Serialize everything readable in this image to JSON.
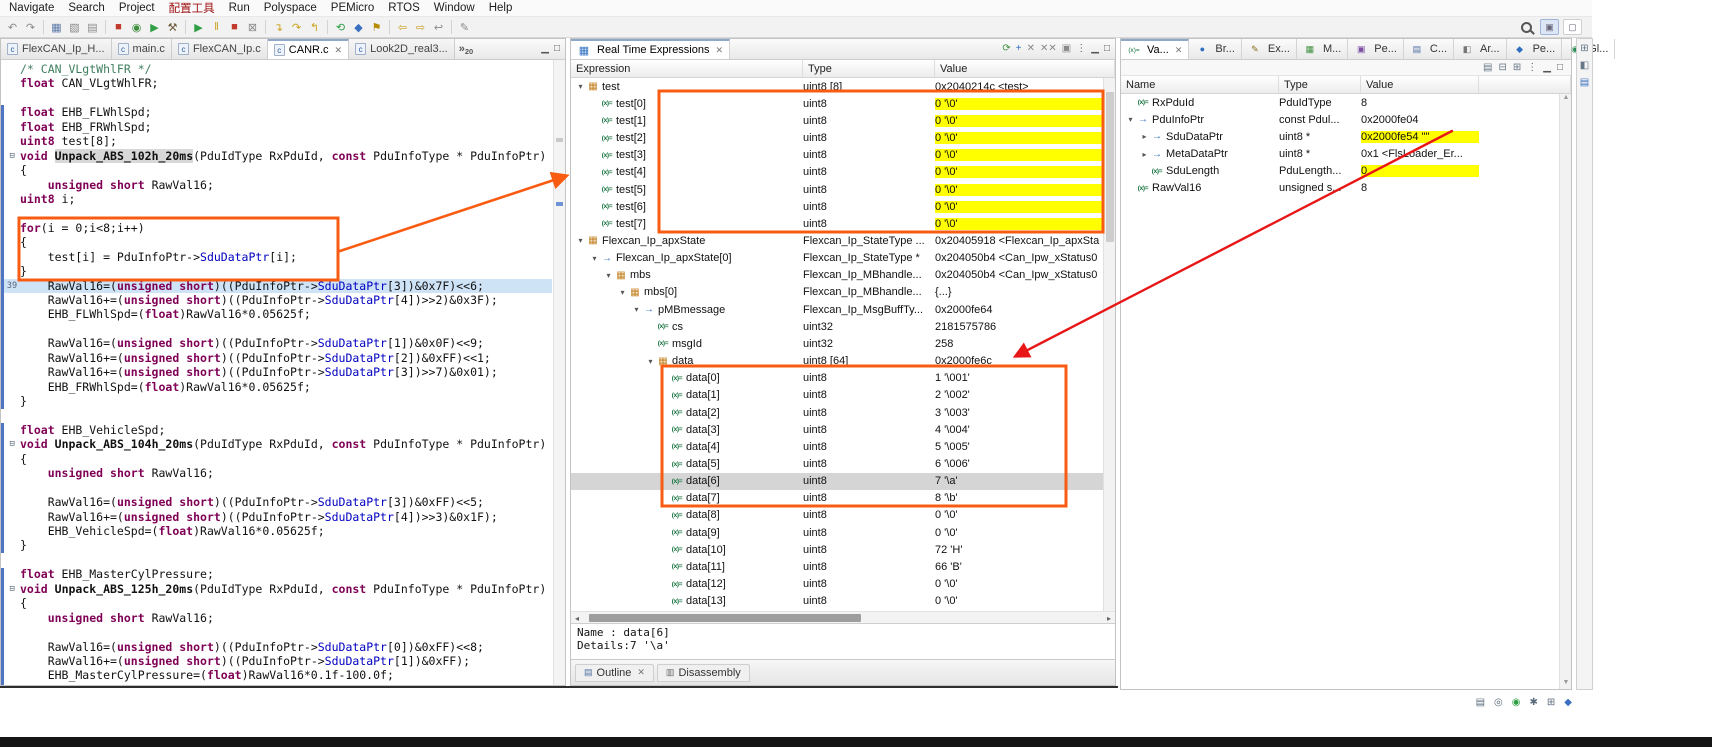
{
  "colors": {
    "annotation_orange": "#f85c12",
    "annotation_red": "#e81717",
    "highlight_yellow": "#ffff00",
    "current_line_blue": "#cfe3f7",
    "selection_gray": "#d5d5d5",
    "keyword_maroon": "#7f0055",
    "comment_green": "#3f7f5f",
    "member_blue": "#0000c0",
    "menu_accent_red": "#a01313",
    "change_bar_blue": "#4f74c4"
  },
  "menu": {
    "items": [
      {
        "id": "navigate",
        "label": "Navigate"
      },
      {
        "id": "search",
        "label": "Search"
      },
      {
        "id": "project",
        "label": "Project"
      },
      {
        "id": "config-tool",
        "label": "配置工具",
        "accent": true
      },
      {
        "id": "run",
        "label": "Run"
      },
      {
        "id": "polyspace",
        "label": "Polyspace"
      },
      {
        "id": "pemicro",
        "label": "PEMicro"
      },
      {
        "id": "rtos",
        "label": "RTOS"
      },
      {
        "id": "window",
        "label": "Window"
      },
      {
        "id": "help",
        "label": "Help"
      }
    ]
  },
  "toolbar": {
    "items": [
      {
        "name": "undo-icon",
        "glyph": "↶",
        "color": "#8a8a8a"
      },
      {
        "name": "redo-icon",
        "glyph": "↷",
        "color": "#8a8a8a"
      },
      {
        "sep": true
      },
      {
        "name": "save-icon",
        "glyph": "▦",
        "color": "#5b7aa8"
      },
      {
        "name": "save-all-icon",
        "glyph": "▧",
        "color": "#8a8a8a"
      },
      {
        "name": "print-icon",
        "glyph": "▤",
        "color": "#8a8a8a"
      },
      {
        "sep": true
      },
      {
        "name": "stop-icon",
        "glyph": "■",
        "color": "#c0392b"
      },
      {
        "name": "debug-icon",
        "glyph": "◉",
        "color": "#3f8f3f"
      },
      {
        "name": "run-icon",
        "glyph": "▶",
        "color": "#2f9e44"
      },
      {
        "name": "build-icon",
        "glyph": "⚒",
        "color": "#6e5b3c"
      },
      {
        "sep": true
      },
      {
        "name": "resume-icon",
        "glyph": "▶",
        "color": "#2f9e44"
      },
      {
        "name": "suspend-icon",
        "glyph": "‖",
        "color": "#caa21a"
      },
      {
        "name": "terminate-icon",
        "glyph": "■",
        "color": "#c0392b"
      },
      {
        "name": "disconnect-icon",
        "glyph": "⊠",
        "color": "#8a8a8a"
      },
      {
        "sep": true
      },
      {
        "name": "step-into-icon",
        "glyph": "↴",
        "color": "#caa21a"
      },
      {
        "name": "step-over-icon",
        "glyph": "↷",
        "color": "#caa21a"
      },
      {
        "name": "step-return-icon",
        "glyph": "↰",
        "color": "#caa21a"
      },
      {
        "sep": true
      },
      {
        "name": "restart-icon",
        "glyph": "⟲",
        "color": "#2f9e44"
      },
      {
        "name": "pemicro-tool-icon",
        "glyph": "◆",
        "color": "#3b6fbf"
      },
      {
        "name": "flag-icon",
        "glyph": "⚑",
        "color": "#b58900"
      },
      {
        "sep": true
      },
      {
        "name": "back-icon",
        "glyph": "⇦",
        "color": "#c9a227"
      },
      {
        "name": "forward-icon",
        "glyph": "⇨",
        "color": "#c9a227"
      },
      {
        "name": "last-edit-icon",
        "glyph": "↩",
        "color": "#8a8a8a"
      },
      {
        "sep": true
      },
      {
        "name": "annotation-icon",
        "glyph": "✎",
        "color": "#8a8a8a"
      }
    ]
  },
  "editor": {
    "tabs": [
      {
        "label": "FlexCAN_Ip_H...",
        "selected": false
      },
      {
        "label": "main.c",
        "selected": false
      },
      {
        "label": "FlexCAN_Ip.c",
        "selected": false
      },
      {
        "label": "CANR.c",
        "selected": true
      },
      {
        "label": "Look2D_real3...",
        "selected": false
      }
    ],
    "overflow": {
      "glyph": "»",
      "count": "20"
    },
    "window_icons": [
      {
        "name": "minimize-icon",
        "glyph": "▁",
        "color": "#555555"
      },
      {
        "name": "maximize-icon",
        "glyph": "□",
        "color": "#555555"
      }
    ],
    "gutter_number": "39",
    "current_line": 15,
    "fold_lines": [
      6,
      26,
      36
    ],
    "lines": [
      "/* CAN_VLgtWhlFR */",
      "float CAN_VLgtWhlFR;",
      "",
      "float EHB_FLWhlSpd;",
      "float EHB_FRWhlSpd;",
      "uint8 test[8];",
      "void Unpack_ABS_102h_20ms(PduIdType RxPduId, const PduInfoType * PduInfoPtr)",
      "{",
      "    unsigned short RawVal16;",
      "uint8 i;",
      "",
      "for(i = 0;i<8;i++)",
      "{",
      "    test[i] = PduInfoPtr->SduDataPtr[i];",
      "}",
      "    RawVal16=(unsigned short)((PduInfoPtr->SduDataPtr[3])&0x7F)<<6;",
      "    RawVal16+=(unsigned short)((PduInfoPtr->SduDataPtr[4])>>2)&0x3F);",
      "    EHB_FLWhlSpd=(float)RawVal16*0.05625f;",
      "",
      "    RawVal16=(unsigned short)((PduInfoPtr->SduDataPtr[1])&0x0F)<<9;",
      "    RawVal16+=(unsigned short)((PduInfoPtr->SduDataPtr[2])&0xFF)<<1;",
      "    RawVal16+=(unsigned short)((PduInfoPtr->SduDataPtr[3])>>7)&0x01);",
      "    EHB_FRWhlSpd=(float)RawVal16*0.05625f;",
      "}",
      "",
      "float EHB_VehicleSpd;",
      "void Unpack_ABS_104h_20ms(PduIdType RxPduId, const PduInfoType * PduInfoPtr)",
      "{",
      "    unsigned short RawVal16;",
      "",
      "    RawVal16=(unsigned short)((PduInfoPtr->SduDataPtr[3])&0xFF)<<5;",
      "    RawVal16+=(unsigned short)((PduInfoPtr->SduDataPtr[4])>>3)&0x1F);",
      "    EHB_VehicleSpd=(float)RawVal16*0.05625f;",
      "}",
      "",
      "float EHB_MasterCylPressure;",
      "void Unpack_ABS_125h_20ms(PduIdType RxPduId, const PduInfoType * PduInfoPtr)",
      "{",
      "    unsigned short RawVal16;",
      "",
      "    RawVal16=(unsigned short)((PduInfoPtr->SduDataPtr[0])&0xFF)<<8;",
      "    RawVal16+=(unsigned short)((PduInfoPtr->SduDataPtr[1])&0xFF);",
      "    EHB_MasterCylPressure=(float)RawVal16*0.1f-100.0f;"
    ]
  },
  "rte": {
    "title": "Real Time Expressions",
    "columns": [
      "Expression",
      "Type",
      "Value"
    ],
    "header_icons": [
      {
        "name": "refresh-icon",
        "glyph": "⟳",
        "color": "#3f8f3f"
      },
      {
        "name": "add-expression-icon",
        "glyph": "+",
        "color": "#2f6fc0"
      },
      {
        "name": "remove-icon",
        "glyph": "✕",
        "color": "#888888"
      },
      {
        "name": "remove-all-icon",
        "glyph": "✕✕",
        "color": "#888888"
      },
      {
        "name": "snapshot-icon",
        "glyph": "▣",
        "color": "#888888"
      },
      {
        "name": "view-menu-icon",
        "glyph": "⋮",
        "color": "#555555"
      },
      {
        "name": "minimize-icon",
        "glyph": "▁",
        "color": "#555555"
      },
      {
        "name": "maximize-icon",
        "glyph": "□",
        "color": "#555555"
      }
    ],
    "rows": [
      {
        "lvl": 0,
        "exp": "open",
        "icon": "arr",
        "name": "test",
        "type": "uint8 [8]",
        "value": "0x2040214c <test>"
      },
      {
        "lvl": 1,
        "icon": "var",
        "name": "test[0]",
        "type": "uint8",
        "value": "0 '\\0'",
        "hl": true
      },
      {
        "lvl": 1,
        "icon": "var",
        "name": "test[1]",
        "type": "uint8",
        "value": "0 '\\0'",
        "hl": true
      },
      {
        "lvl": 1,
        "icon": "var",
        "name": "test[2]",
        "type": "uint8",
        "value": "0 '\\0'",
        "hl": true
      },
      {
        "lvl": 1,
        "icon": "var",
        "name": "test[3]",
        "type": "uint8",
        "value": "0 '\\0'",
        "hl": true
      },
      {
        "lvl": 1,
        "icon": "var",
        "name": "test[4]",
        "type": "uint8",
        "value": "0 '\\0'",
        "hl": true
      },
      {
        "lvl": 1,
        "icon": "var",
        "name": "test[5]",
        "type": "uint8",
        "value": "0 '\\0'",
        "hl": true
      },
      {
        "lvl": 1,
        "icon": "var",
        "name": "test[6]",
        "type": "uint8",
        "value": "0 '\\0'",
        "hl": true
      },
      {
        "lvl": 1,
        "icon": "var",
        "name": "test[7]",
        "type": "uint8",
        "value": "0 '\\0'",
        "hl": true
      },
      {
        "lvl": 0,
        "exp": "open",
        "icon": "arr",
        "name": "Flexcan_Ip_apxState",
        "type": "Flexcan_Ip_StateType ...",
        "value": "0x20405918 <Flexcan_Ip_apxSta"
      },
      {
        "lvl": 1,
        "exp": "open",
        "icon": "ptr",
        "name": "Flexcan_Ip_apxState[0]",
        "type": "Flexcan_Ip_StateType *",
        "value": "0x204050b4 <Can_Ipw_xStatus0"
      },
      {
        "lvl": 2,
        "exp": "open",
        "icon": "arr",
        "name": "mbs",
        "type": "Flexcan_Ip_MBhandle...",
        "value": "0x204050b4 <Can_Ipw_xStatus0"
      },
      {
        "lvl": 3,
        "exp": "open",
        "icon": "arr",
        "name": "mbs[0]",
        "type": "Flexcan_Ip_MBhandle...",
        "value": "{...}"
      },
      {
        "lvl": 4,
        "exp": "open",
        "icon": "ptr",
        "name": "pMBmessage",
        "type": "Flexcan_Ip_MsgBuffTy...",
        "value": "0x2000fe64"
      },
      {
        "lvl": 5,
        "icon": "var",
        "name": "cs",
        "type": "uint32",
        "value": "2181575786"
      },
      {
        "lvl": 5,
        "icon": "var",
        "name": "msgId",
        "type": "uint32",
        "value": "258"
      },
      {
        "lvl": 5,
        "exp": "open",
        "icon": "arr",
        "name": "data",
        "type": "uint8 [64]",
        "value": "0x2000fe6c"
      },
      {
        "lvl": 6,
        "icon": "var",
        "name": "data[0]",
        "type": "uint8",
        "value": "1 '\\001'"
      },
      {
        "lvl": 6,
        "icon": "var",
        "name": "data[1]",
        "type": "uint8",
        "value": "2 '\\002'"
      },
      {
        "lvl": 6,
        "icon": "var",
        "name": "data[2]",
        "type": "uint8",
        "value": "3 '\\003'"
      },
      {
        "lvl": 6,
        "icon": "var",
        "name": "data[3]",
        "type": "uint8",
        "value": "4 '\\004'"
      },
      {
        "lvl": 6,
        "icon": "var",
        "name": "data[4]",
        "type": "uint8",
        "value": "5 '\\005'"
      },
      {
        "lvl": 6,
        "icon": "var",
        "name": "data[5]",
        "type": "uint8",
        "value": "6 '\\006'"
      },
      {
        "lvl": 6,
        "icon": "var",
        "name": "data[6]",
        "type": "uint8",
        "value": "7 '\\a'",
        "sel": true
      },
      {
        "lvl": 6,
        "icon": "var",
        "name": "data[7]",
        "type": "uint8",
        "value": "8 '\\b'"
      },
      {
        "lvl": 6,
        "icon": "var",
        "name": "data[8]",
        "type": "uint8",
        "value": "0 '\\0'"
      },
      {
        "lvl": 6,
        "icon": "var",
        "name": "data[9]",
        "type": "uint8",
        "value": "0 '\\0'"
      },
      {
        "lvl": 6,
        "icon": "var",
        "name": "data[10]",
        "type": "uint8",
        "value": "72 'H'"
      },
      {
        "lvl": 6,
        "icon": "var",
        "name": "data[11]",
        "type": "uint8",
        "value": "66 'B'"
      },
      {
        "lvl": 6,
        "icon": "var",
        "name": "data[12]",
        "type": "uint8",
        "value": "0 '\\0'"
      },
      {
        "lvl": 6,
        "icon": "var",
        "name": "data[13]",
        "type": "uint8",
        "value": "0 '\\0'"
      }
    ],
    "details": {
      "line1": "Name : data[6]",
      "line2": "Details:7 '\\a'"
    }
  },
  "bottom_tabs": [
    {
      "label": "Outline",
      "icon_name": "outline-icon",
      "glyph": "▤",
      "color": "#4f6fa0",
      "close": true
    },
    {
      "label": "Disassembly",
      "icon_name": "disassembly-icon",
      "glyph": "▥",
      "color": "#6a6a6a",
      "close": false
    }
  ],
  "variables": {
    "tabs": [
      {
        "label": "Va...",
        "selected": true,
        "icon_name": "variables-icon",
        "glyph": "(x)=",
        "color": "#0e6e38"
      },
      {
        "label": "Br...",
        "selected": false,
        "icon_name": "breakpoints-icon",
        "glyph": "●",
        "color": "#2f6fc0"
      },
      {
        "label": "Ex...",
        "selected": false,
        "icon_name": "expressions-icon",
        "glyph": "✎",
        "color": "#8a6d1f"
      },
      {
        "label": "M...",
        "selected": false,
        "icon_name": "memory-icon",
        "glyph": "▦",
        "color": "#3f8f3f"
      },
      {
        "label": "Pe...",
        "selected": false,
        "icon_name": "peripherals-icon",
        "glyph": "▣",
        "color": "#7c4fa0"
      },
      {
        "label": "C...",
        "selected": false,
        "icon_name": "cache-icon",
        "glyph": "▤",
        "color": "#4f6fa0"
      },
      {
        "label": "Ar...",
        "selected": false,
        "icon_name": "arrays-icon",
        "glyph": "◧",
        "color": "#777777"
      },
      {
        "label": "Pe...",
        "selected": false,
        "icon_name": "pemicro-icon",
        "glyph": "◆",
        "color": "#2f6fc0"
      },
      {
        "label": "Gl...",
        "selected": false,
        "icon_name": "globals-icon",
        "glyph": "◉",
        "color": "#2e8b57"
      }
    ],
    "toolbar_icons": [
      {
        "name": "show-columns-icon",
        "glyph": "▤",
        "color": "#667788"
      },
      {
        "name": "collapse-all-icon",
        "glyph": "⊟",
        "color": "#667788"
      },
      {
        "name": "layout-icon",
        "glyph": "⊞",
        "color": "#667788"
      },
      {
        "name": "view-menu-icon",
        "glyph": "⋮",
        "color": "#555555"
      },
      {
        "name": "minimize-icon",
        "glyph": "▁",
        "color": "#555555"
      },
      {
        "name": "maximize-icon",
        "glyph": "□",
        "color": "#555555"
      }
    ],
    "columns": [
      "Name",
      "Type",
      "Value"
    ],
    "rows": [
      {
        "lvl": 0,
        "icon": "var",
        "name": "RxPduId",
        "type": "PduIdType",
        "value": "8"
      },
      {
        "lvl": 0,
        "exp": "open",
        "icon": "ptr",
        "name": "PduInfoPtr",
        "type": "const Pdul...",
        "value": "0x2000fe04"
      },
      {
        "lvl": 1,
        "exp": "closed",
        "icon": "ptr",
        "name": "SduDataPtr",
        "type": "uint8 *",
        "value": "0x2000fe54 \"\"",
        "hl": true
      },
      {
        "lvl": 1,
        "exp": "closed",
        "icon": "ptr",
        "name": "MetaDataPtr",
        "type": "uint8 *",
        "value": "0x1 <FlsLoader_Er..."
      },
      {
        "lvl": 1,
        "icon": "var",
        "name": "SduLength",
        "type": "PduLength...",
        "value": "0",
        "hl": true
      },
      {
        "lvl": 0,
        "icon": "var",
        "name": "RawVal16",
        "type": "unsigned s...",
        "value": "8"
      }
    ]
  },
  "side_strip_icons": [
    {
      "name": "restore-panel-icon",
      "glyph": "⊞",
      "color": "#667788"
    },
    {
      "name": "outline-strip-icon",
      "glyph": "◧",
      "color": "#667788"
    },
    {
      "name": "view-strip-icon",
      "glyph": "▤",
      "color": "#3b6fbf"
    }
  ],
  "min_bar_icons": [
    {
      "name": "restore-view-icon",
      "glyph": "▤",
      "color": "#5a6b7c"
    },
    {
      "name": "pin-view-icon",
      "glyph": "◎",
      "color": "#5a6b7c"
    },
    {
      "name": "device-status-icon",
      "glyph": "◉",
      "color": "#2e9e44"
    },
    {
      "name": "snippet-view-icon",
      "glyph": "✱",
      "color": "#5a6b7c"
    },
    {
      "name": "grid-view-icon",
      "glyph": "⊞",
      "color": "#5a6b7c"
    },
    {
      "name": "pemicro-view-icon",
      "glyph": "◆",
      "color": "#3b6fbf"
    }
  ]
}
